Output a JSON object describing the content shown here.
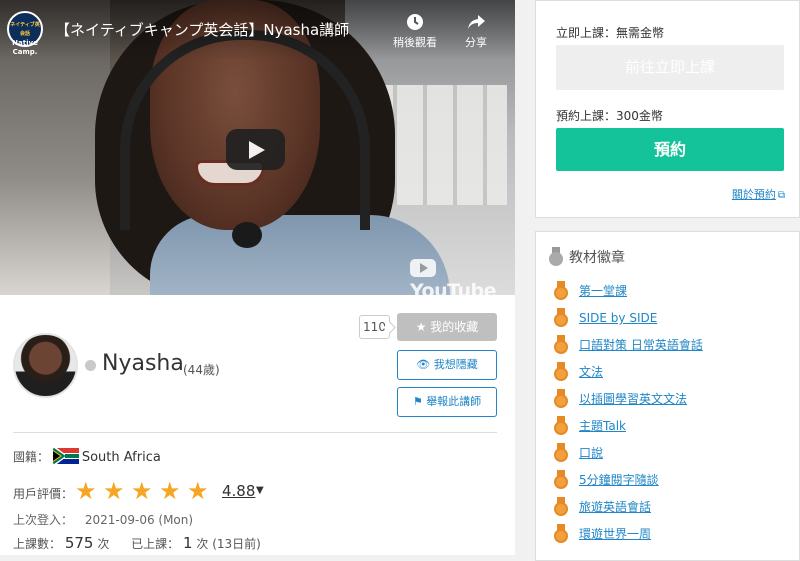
{
  "video": {
    "title": "【ネイティブキャンプ英会話】Nyasha講師",
    "logo_top": "ネイティブ英会話",
    "logo_line1": "Native",
    "logo_line2": "Camp.",
    "watch_later_label": "稍後觀看",
    "share_label": "分享",
    "youtube_label": "YouTube",
    "icons": {
      "watch_later": "clock-icon",
      "share": "share-icon",
      "play": "play-icon"
    }
  },
  "teacher": {
    "favorite_count": "110",
    "favorite_label": "我的收藏",
    "hide_label": "我想隱藏",
    "report_label": "舉報此講師",
    "name": "Nyasha",
    "age": "(44歲)",
    "nationality_label": "國籍：",
    "country": "South Africa",
    "rating_label": "用戶評價：",
    "rating_stars": 5,
    "rating_value": "4.88",
    "last_login_label": "上次登入：",
    "last_login_value": "2021-09-06 (Mon)",
    "lessons_label": "上課數：",
    "lessons_count": "575",
    "lessons_unit": "次",
    "taken_label": "已上課：",
    "taken_count": "1",
    "taken_unit": "次 (13日前)"
  },
  "booking": {
    "instant_label": "立即上課：無需金幣",
    "instant_button": "前往立即上課",
    "reserve_label": "預約上課：300金幣",
    "reserve_button": "預約",
    "about_link": "關於預約"
  },
  "materials": {
    "heading": "教材徽章",
    "items": [
      "第一堂課",
      "SIDE by SIDE",
      "口語對策 日常英語會話",
      "文法",
      "以插圖學習英文文法",
      "主題Talk",
      "口說",
      "5分鐘閱字隨談",
      "旅遊英語會話",
      "環遊世界一周"
    ]
  },
  "colors": {
    "accent_green": "#15c39a",
    "link_blue": "#1f86c7",
    "star_orange": "#f5a623",
    "medal_orange": "#f2a03d"
  }
}
